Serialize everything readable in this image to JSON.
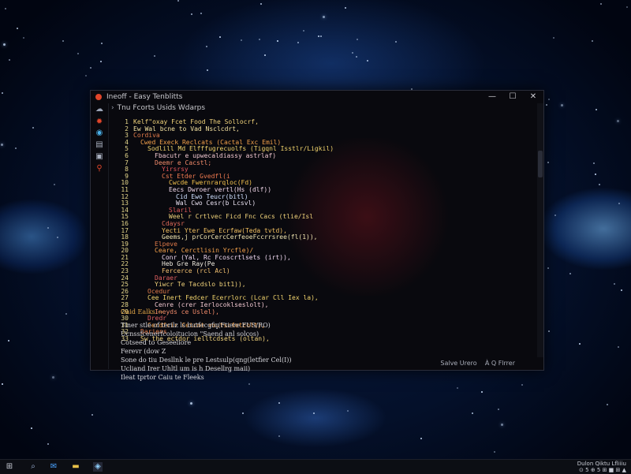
{
  "window": {
    "title": "Ineoff - Easy Tenblitts",
    "breadcrumb": "Tnu Fcorts Usids Wdarps",
    "controls": {
      "minimize": "—",
      "maximize": "☐",
      "close": "✕"
    }
  },
  "sidebar": {
    "icons": [
      "cloud-icon",
      "bug-icon",
      "chat-icon",
      "folder-icon",
      "terminal-icon",
      "link-icon"
    ]
  },
  "code_lines": [
    {
      "n": "1",
      "indent": 0,
      "text": "Kelf\"oxay Fcet Food The Sollocrf,",
      "color": "#f0d27a"
    },
    {
      "n": "2",
      "indent": 0,
      "text": "Ew Wal bcne to Vad Nsclcdrt,",
      "color": "#f4e2a0"
    },
    {
      "n": "3",
      "indent": 0,
      "text": "Cordiva",
      "color": "#e07a4a"
    },
    {
      "n": "4",
      "indent": 1,
      "text": "Cwed Execk Reclcats (Cactal Exc Emil)",
      "color": "#f2a04a"
    },
    {
      "n": "5",
      "indent": 2,
      "text": "Sodlill Md Elfffugrecuolfs (Tigqnl Isstlr/Ligkil)",
      "color": "#f2d46c"
    },
    {
      "n": "6",
      "indent": 3,
      "text": "Fbacutr e upwecaldiassy astrlaf)",
      "color": "#f0c6cf"
    },
    {
      "n": "7",
      "indent": 3,
      "text": "Deemr e Cacstl;",
      "color": "#f08a6a"
    },
    {
      "n": "8",
      "indent": 4,
      "text": "Yirsrsy",
      "color": "#e2555a"
    },
    {
      "n": "9",
      "indent": 4,
      "text": "Cst Etder Gvedfl(i",
      "color": "#f07a50"
    },
    {
      "n": "10",
      "indent": 5,
      "text": "Cwcde Fwernrarqloc(Fd)",
      "color": "#f3c24e"
    },
    {
      "n": "11",
      "indent": 5,
      "text": "Eecs Dwroer vertl(Hs (dlf))",
      "color": "#f0d6e8"
    },
    {
      "n": "12",
      "indent": 6,
      "text": "Cid Ewo Teucr(bitl)",
      "color": "#cfe0ff"
    },
    {
      "n": "13",
      "indent": 6,
      "text": "Wal Cwo Cesr(b Lcsvl)",
      "color": "#e8e0f0"
    },
    {
      "n": "14",
      "indent": 5,
      "text": "Slaril",
      "color": "#e05a5a"
    },
    {
      "n": "15",
      "indent": 5,
      "text": "Weel r Crtlvec Ficd Fnc Cacs (tlie/Isl",
      "color": "#f0d27a"
    },
    {
      "n": "16",
      "indent": 4,
      "text": "Cdaysr",
      "color": "#e06a5a"
    },
    {
      "n": "17",
      "indent": 4,
      "text": "Yecti Yter Ewe Ecrfaw(Teda tvtd),",
      "color": "#f2c060"
    },
    {
      "n": "18",
      "indent": 4,
      "text": "Geems,j prCorCercCerfeoeFccrrsree(fl(1)),",
      "color": "#f0e4b0"
    },
    {
      "n": "19",
      "indent": 3,
      "text": "Elpeve",
      "color": "#e07a4a"
    },
    {
      "n": "20",
      "indent": 3,
      "text": "Ceare, Cerctlisin Yrcfle)/",
      "color": "#f2a04a"
    },
    {
      "n": "21",
      "indent": 4,
      "text": "Conr (Yal, Rc Fcoscrtlsets (irt)),",
      "color": "#f0d8f0"
    },
    {
      "n": "22",
      "indent": 4,
      "text": "Heb Gre Ray(Pe",
      "color": "#f0ece0"
    },
    {
      "n": "23",
      "indent": 4,
      "text": "Fercerce (rcl Acl)",
      "color": "#f2c070"
    },
    {
      "n": "24",
      "indent": 3,
      "text": "Daraer",
      "color": "#e06060"
    },
    {
      "n": "25",
      "indent": 3,
      "text": "Yiwcr Te Tacdslo bit1)),",
      "color": "#f0d27a"
    },
    {
      "n": "26",
      "indent": 2,
      "text": "Ocedur",
      "color": "#e07a4a"
    },
    {
      "n": "27",
      "indent": 2,
      "text": "Cee Inert Fedcer Ecerrlorc (Lcar Cll Iex la),",
      "color": "#f2d46c"
    },
    {
      "n": "28",
      "indent": 3,
      "text": "Cenre (crer Ierlocoklseslolt),",
      "color": "#f0c6cf"
    },
    {
      "n": "29",
      "indent": 3,
      "text": "Ineyds ce Uslel),",
      "color": "#f08a6a"
    },
    {
      "n": "30",
      "indent": 2,
      "text": "Dredr",
      "color": "#e06060"
    },
    {
      "n": "31",
      "indent": 2,
      "text": "Cerdfcir Cetcnt voutscfetcolt),",
      "color": "#f2a04a"
    },
    {
      "n": "32",
      "indent": 1,
      "text": "Dariens",
      "color": "#e07a4a"
    },
    {
      "n": "33",
      "indent": 1,
      "text": "Sw the ectdor ielltcdsets (oltan),",
      "color": "#f0d27a"
    }
  ],
  "output": {
    "heading": "Oaid Ealks —",
    "lines": [
      "Tiner stle of terilz ls butfecgfq(Ftiere FUS/RO)",
      "Ucnssfcenerfcoloitucion \"Saend anl solcos)",
      "Cotseed to Geseeliore",
      "Ferevr (dow Z",
      "Sone do tiu Desllnk le pre Lestsulp(qng(letfier Cel(I))",
      "Ucliand Irer Uhltl um is h Desellrg maii)",
      "Ileat tprtor Caiu te Fleeks"
    ]
  },
  "status": {
    "text": "Salve Urero",
    "position": "À Q Flrrer"
  },
  "taskbar": {
    "items": [
      "start-icon",
      "search-icon",
      "mail-icon",
      "files-icon",
      "app-icon"
    ],
    "tray_top": "Dulon Qiktu Lfliiiu",
    "tray_bottom": "⊙ 5 ⊕ 5 ⊞ ■ ⊞ ▲"
  },
  "colors": {
    "accent_red": "#e0452a",
    "line_numbers": "#e2d48a",
    "output_heading": "#e2a647"
  }
}
